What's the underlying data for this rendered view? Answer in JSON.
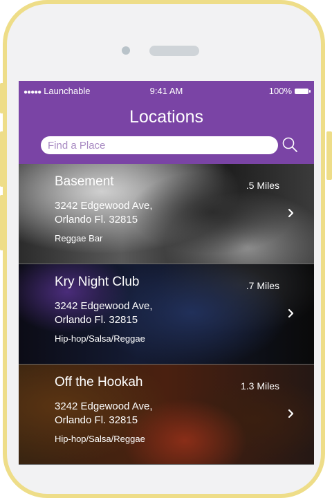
{
  "status_bar": {
    "carrier": "Launchable",
    "time": "9:41 AM",
    "battery": "100%"
  },
  "header": {
    "title": "Locations",
    "search_placeholder": "Find a Place"
  },
  "locations": [
    {
      "name": "Basement",
      "distance": ".5 Miles",
      "address_line1": "3242 Edgewood Ave,",
      "address_line2": "Orlando Fl. 32815",
      "genre": "Reggae Bar"
    },
    {
      "name": "Kry Night Club",
      "distance": ".7 Miles",
      "address_line1": "3242 Edgewood Ave,",
      "address_line2": "Orlando Fl. 32815",
      "genre": "Hip-hop/Salsa/Reggae"
    },
    {
      "name": "Off the Hookah",
      "distance": "1.3 Miles",
      "address_line1": "3242 Edgewood Ave,",
      "address_line2": "Orlando Fl. 32815",
      "genre": "Hip-hop/Salsa/Reggae"
    }
  ],
  "colors": {
    "header_purple": "#7a44a5",
    "frame_gold": "#eedd88",
    "placeholder": "#a88ac2"
  },
  "icons": [
    "search-icon",
    "chevron-right-icon",
    "battery-icon",
    "signal-dots-icon"
  ]
}
